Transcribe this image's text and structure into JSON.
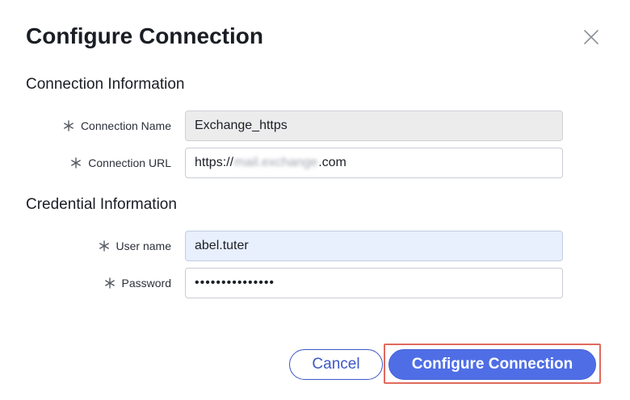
{
  "dialog": {
    "title": "Configure Connection",
    "close_icon": "close-icon"
  },
  "sections": {
    "connection": {
      "title": "Connection Information",
      "fields": {
        "name": {
          "label": "Connection Name",
          "value": "Exchange_https",
          "required": true,
          "readonly": true
        },
        "url": {
          "label": "Connection URL",
          "value_prefix": "https://",
          "value_obscured": "mail.exchange",
          "value_suffix": ".com",
          "required": true
        }
      }
    },
    "credential": {
      "title": "Credential Information",
      "fields": {
        "username": {
          "label": "User name",
          "value": "abel.tuter",
          "required": true
        },
        "password": {
          "label": "Password",
          "value": "•••••••••••••••",
          "required": true
        }
      }
    }
  },
  "actions": {
    "cancel_label": "Cancel",
    "submit_label": "Configure Connection"
  },
  "colors": {
    "primary": "#4f6ee6",
    "primary_text": "#3e58c6",
    "highlight": "#e06a5d",
    "readonly_bg": "#ececed",
    "autofill_bg": "#e8effd"
  }
}
